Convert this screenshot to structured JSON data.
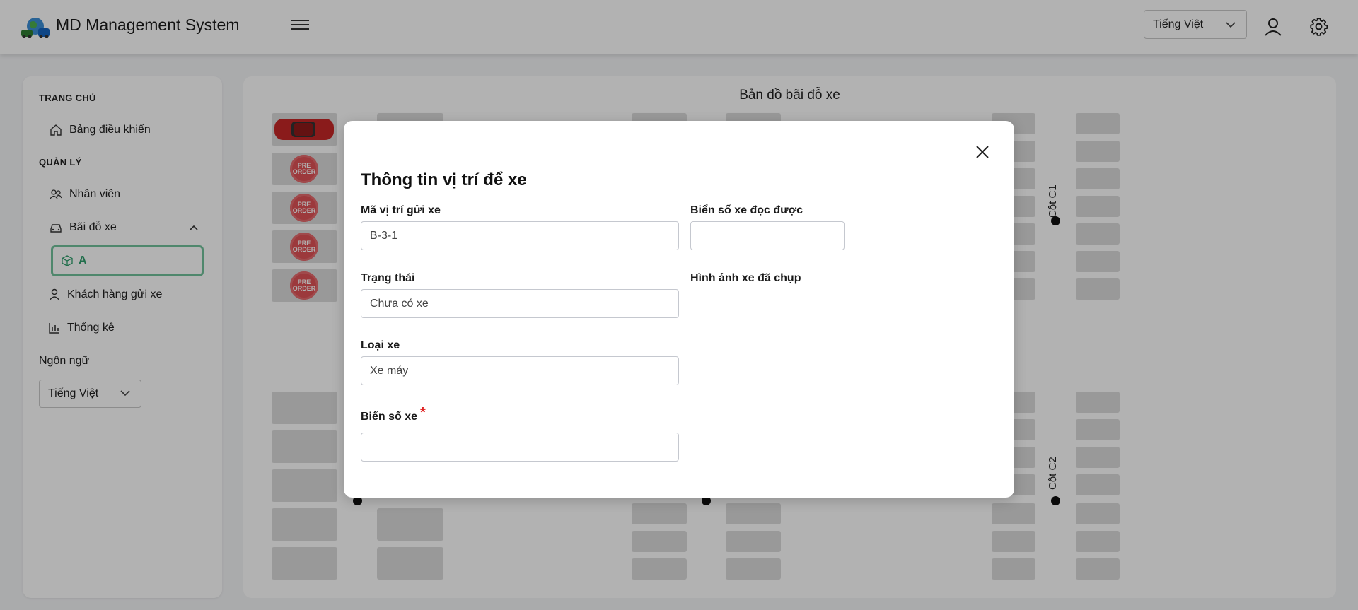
{
  "header": {
    "app_title": "MD Management System",
    "language": "Tiếng Việt"
  },
  "sidebar": {
    "section_home": "TRANG CHỦ",
    "dashboard": "Bảng điều khiển",
    "section_manage": "QUẢN LÝ",
    "staff": "Nhân viên",
    "parking": "Bãi đỗ xe",
    "active_lot": "A",
    "customers": "Khách hàng gửi xe",
    "stats": "Thống kê",
    "language_label": "Ngôn ngữ",
    "language": "Tiếng Việt"
  },
  "map": {
    "title": "Bản đồ bãi đỗ xe",
    "column_1": "Cột C1",
    "column_2": "Cột C2",
    "preorder_text": "PRE ORDER"
  },
  "modal": {
    "title": "Thông tin vị trí để xe",
    "slot_code_label": "Mã vị trí gửi xe",
    "slot_code_value": "B-3-1",
    "plate_read_label": "Biển số xe đọc được",
    "plate_read_value": "",
    "status_label": "Trạng thái",
    "status_value": "Chưa có xe",
    "photo_label": "Hình ảnh xe đã chụp",
    "vehicle_type_label": "Loại xe",
    "vehicle_type_value": "Xe máy",
    "plate_label": "Biển số xe",
    "plate_required_mark": "*",
    "plate_value": ""
  }
}
